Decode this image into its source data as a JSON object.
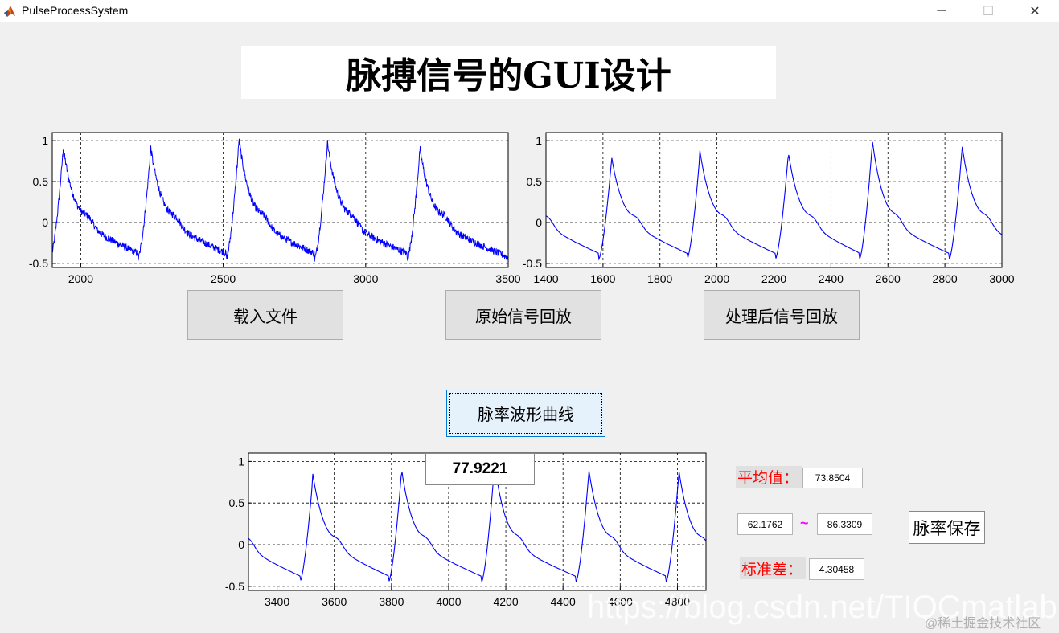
{
  "window": {
    "title": "PulseProcessSystem",
    "minimize_glyph": "─",
    "maximize_glyph": "☐",
    "close_glyph": "✕",
    "icon": "matlab-logo-icon"
  },
  "heading": "脉搏信号的GUI设计",
  "buttons": {
    "load_file": "载入文件",
    "play_original": "原始信号回放",
    "play_processed": "处理后信号回放",
    "pulse_rate_curve": "脉率波形曲线",
    "save_rate": "脉率保存"
  },
  "stats": {
    "mean_label": "平均值：",
    "mean_value": "73.8504",
    "range_min": "62.1762",
    "range_sep": "~",
    "range_max": "86.3309",
    "std_label": "标准差：",
    "std_value": "4.30458"
  },
  "readout_value": "77.9221",
  "watermark": "https://blog.csdn.net/TIQCmatlab",
  "watermark2": "@稀土掘金技术社区",
  "colors": {
    "line": "#0000ff",
    "label_red": "#ff0000",
    "tilde": "#ff00ff"
  },
  "chart_data": [
    {
      "type": "line",
      "name": "raw-signal",
      "xlim": [
        1900,
        3500
      ],
      "ylim": [
        -0.55,
        1.1
      ],
      "xticks": [
        2000,
        2500,
        3000,
        3500
      ],
      "yticks": [
        -0.5,
        0,
        0.5,
        1
      ],
      "xticklabels": [
        "2000",
        "2500",
        "3000",
        "3500"
      ],
      "yticklabels": [
        "-0.5",
        "0",
        "0.5",
        "1"
      ],
      "grid": true,
      "noisy": true,
      "peaks": [
        1938,
        2245,
        2555,
        2865,
        3190
      ],
      "peak_heights": [
        0.88,
        0.88,
        0.98,
        0.95,
        0.87
      ]
    },
    {
      "type": "line",
      "name": "processed-signal",
      "xlim": [
        1400,
        3000
      ],
      "ylim": [
        -0.55,
        1.1
      ],
      "xticks": [
        1400,
        1600,
        1800,
        2000,
        2200,
        2400,
        2600,
        2800,
        3000
      ],
      "yticks": [
        -0.5,
        0,
        0.5,
        1
      ],
      "xticklabels": [
        "1400",
        "1600",
        "1800",
        "2000",
        "2200",
        "2400",
        "2600",
        "2800",
        "3000"
      ],
      "yticklabels": [
        "-0.5",
        "0",
        "0.5",
        "1"
      ],
      "grid": true,
      "noisy": false,
      "peaks": [
        1630,
        1940,
        2250,
        2545,
        2860
      ],
      "peak_heights": [
        0.76,
        0.83,
        0.82,
        0.96,
        0.9
      ]
    },
    {
      "type": "line",
      "name": "pulse-rate-signal",
      "xlim": [
        3300,
        4900
      ],
      "ylim": [
        -0.55,
        1.1
      ],
      "xticks": [
        3400,
        3600,
        3800,
        4000,
        4200,
        4400,
        4600,
        4800
      ],
      "yticks": [
        -0.5,
        0,
        0.5,
        1
      ],
      "xticklabels": [
        "3400",
        "3600",
        "3800",
        "4000",
        "4200",
        "4400",
        "4600",
        "4800"
      ],
      "yticklabels": [
        "-0.5",
        "0",
        "0.5",
        "1"
      ],
      "grid": true,
      "noisy": false,
      "peaks": [
        3525,
        3835,
        4160,
        4490,
        4805
      ],
      "peak_heights": [
        0.8,
        0.87,
        0.95,
        0.86,
        0.85
      ]
    }
  ]
}
